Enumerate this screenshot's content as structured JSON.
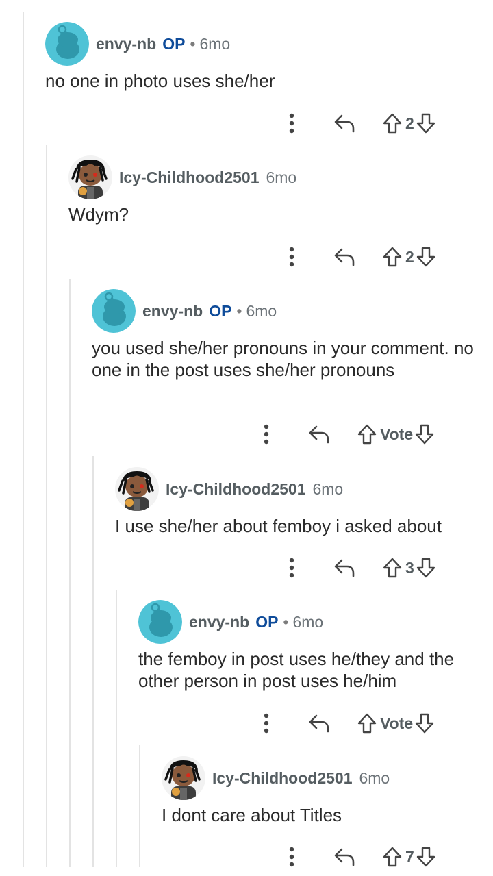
{
  "labels": {
    "op": "OP",
    "separator": "•",
    "vote": "Vote"
  },
  "icons": {
    "more": "more-vertical-icon",
    "reply": "reply-arrow-icon",
    "upvote": "upvote-arrow-icon",
    "downvote": "downvote-arrow-icon"
  },
  "colors": {
    "op_badge": "#0f4c9a",
    "username": "#555d61",
    "thread_line": "#e3e3e3",
    "avatar_teal": "#4fc3d6"
  },
  "comments": [
    {
      "username": "envy-nb",
      "is_op": true,
      "time": "6mo",
      "body": "no one in photo uses she/her",
      "score": "2",
      "avatar": "snoo-teal-avatar"
    },
    {
      "username": "Icy-Childhood2501",
      "is_op": false,
      "time": "6mo",
      "body": "Wdym?",
      "score": "2",
      "avatar": "dreadlocks-avatar"
    },
    {
      "username": "envy-nb",
      "is_op": true,
      "time": "6mo",
      "body": "you used she/her pronouns in your comment. no one in the post uses she/her pronouns",
      "score": "Vote",
      "avatar": "snoo-teal-avatar"
    },
    {
      "username": "Icy-Childhood2501",
      "is_op": false,
      "time": "6mo",
      "body": "I use she/her about femboy i asked about",
      "score": "3",
      "avatar": "dreadlocks-avatar"
    },
    {
      "username": "envy-nb",
      "is_op": true,
      "time": "6mo",
      "body": "the femboy in post uses he/they and the other person in post uses he/him",
      "score": "Vote",
      "avatar": "snoo-teal-avatar"
    },
    {
      "username": "Icy-Childhood2501",
      "is_op": false,
      "time": "6mo",
      "body": "I dont care about Titles",
      "score": "7",
      "avatar": "dreadlocks-avatar"
    }
  ]
}
